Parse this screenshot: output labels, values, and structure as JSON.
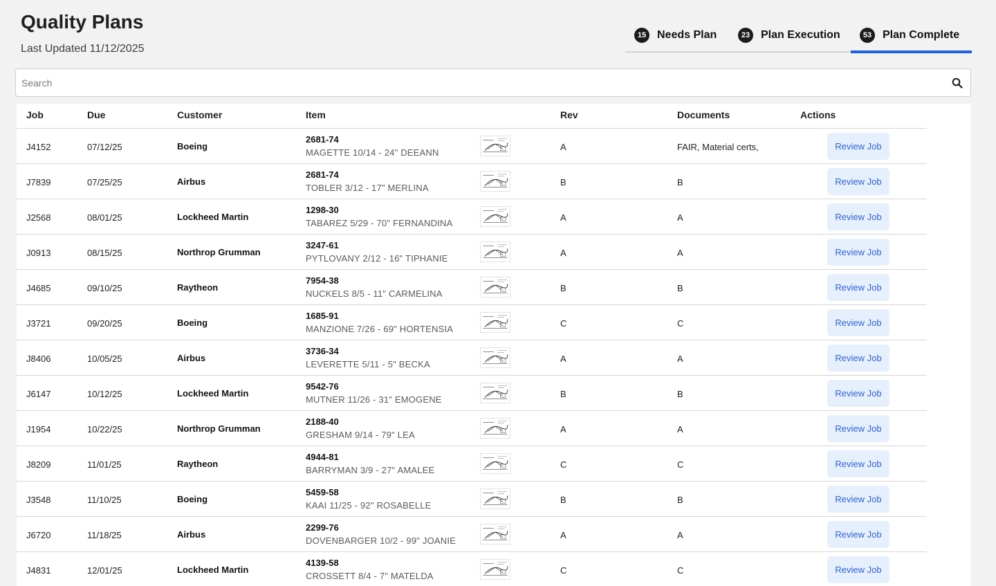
{
  "header": {
    "title": "Quality Plans",
    "last_updated": "Last Updated 11/12/2025"
  },
  "tabs": [
    {
      "count": "15",
      "label": "Needs Plan",
      "active": false
    },
    {
      "count": "23",
      "label": "Plan Execution",
      "active": false
    },
    {
      "count": "53",
      "label": "Plan Complete",
      "active": true
    }
  ],
  "search": {
    "placeholder": "Search",
    "value": ""
  },
  "table": {
    "columns": [
      "Job",
      "Due",
      "Customer",
      "Item",
      "Rev",
      "Documents",
      "Actions"
    ],
    "action_label": "Review Job",
    "rows": [
      {
        "job": "J4152",
        "due": "07/12/25",
        "customer": "Boeing",
        "item_code": "2681-74",
        "item_desc": "MAGETTE 10/14 - 24\" DEEANN",
        "rev": "A",
        "documents": "FAIR, Material certs,"
      },
      {
        "job": "J7839",
        "due": "07/25/25",
        "customer": "Airbus",
        "item_code": "2681-74",
        "item_desc": "TOBLER 3/12 - 17\" MERLINA",
        "rev": "B",
        "documents": "B"
      },
      {
        "job": "J2568",
        "due": "08/01/25",
        "customer": "Lockheed Martin",
        "item_code": "1298-30",
        "item_desc": "TABAREZ 5/29 - 70\" FERNANDINA",
        "rev": "A",
        "documents": "A"
      },
      {
        "job": "J0913",
        "due": "08/15/25",
        "customer": "Northrop Grumman",
        "item_code": "3247-61",
        "item_desc": "PYTLOVANY 2/12 - 16\" TIPHANIE",
        "rev": "A",
        "documents": "A"
      },
      {
        "job": "J4685",
        "due": "09/10/25",
        "customer": "Raytheon",
        "item_code": "7954-38",
        "item_desc": "NUCKELS 8/5 - 11\" CARMELINA",
        "rev": "B",
        "documents": "B"
      },
      {
        "job": "J3721",
        "due": "09/20/25",
        "customer": "Boeing",
        "item_code": "1685-91",
        "item_desc": "MANZIONE 7/26 - 69\" HORTENSIA",
        "rev": "C",
        "documents": "C"
      },
      {
        "job": "J8406",
        "due": "10/05/25",
        "customer": "Airbus",
        "item_code": "3736-34",
        "item_desc": "LEVERETTE 5/11 - 5\" BECKA",
        "rev": "A",
        "documents": "A"
      },
      {
        "job": "J6147",
        "due": "10/12/25",
        "customer": "Lockheed Martin",
        "item_code": "9542-76",
        "item_desc": "MUTNER 11/26 - 31\" EMOGENE",
        "rev": "B",
        "documents": "B"
      },
      {
        "job": "J1954",
        "due": "10/22/25",
        "customer": "Northrop Grumman",
        "item_code": "2188-40",
        "item_desc": "GRESHAM 9/14 - 79\" LEA",
        "rev": "A",
        "documents": "A"
      },
      {
        "job": "J8209",
        "due": "11/01/25",
        "customer": "Raytheon",
        "item_code": "4944-81",
        "item_desc": "BARRYMAN 3/9 - 27\" AMALEE",
        "rev": "C",
        "documents": "C"
      },
      {
        "job": "J3548",
        "due": "11/10/25",
        "customer": "Boeing",
        "item_code": "5459-58",
        "item_desc": "KAAI 11/25 - 92\" ROSABELLE",
        "rev": "B",
        "documents": "B"
      },
      {
        "job": "J6720",
        "due": "11/18/25",
        "customer": "Airbus",
        "item_code": "2299-76",
        "item_desc": "DOVENBARGER 10/2 - 99\" JOANIE",
        "rev": "A",
        "documents": "A"
      },
      {
        "job": "J4831",
        "due": "12/01/25",
        "customer": "Lockheed Martin",
        "item_code": "4139-58",
        "item_desc": "CROSSETT 8/4 - 7\" MATELDA",
        "rev": "C",
        "documents": "C"
      }
    ]
  },
  "icons": {
    "search": "search-icon",
    "thumbnail": "drawing-thumbnail"
  },
  "colors": {
    "accent": "#1d5fe0",
    "button_bg": "#e6effc",
    "button_text": "#2d63d8",
    "badge_bg": "#1c1c1c"
  }
}
